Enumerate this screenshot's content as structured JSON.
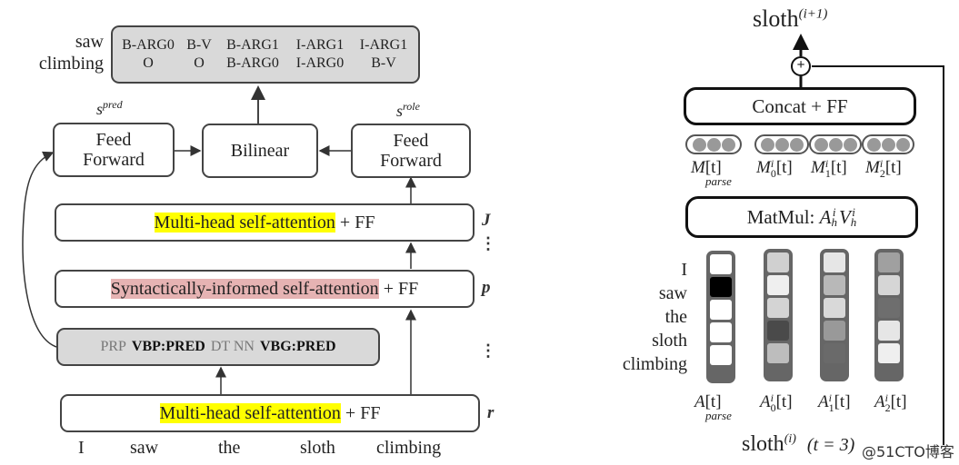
{
  "left_diagram": {
    "output_rows": {
      "row_labels": [
        "saw",
        "climbing"
      ],
      "row1": [
        "B-ARG0",
        "B-V",
        "B-ARG1",
        "I-ARG1",
        "I-ARG1"
      ],
      "row2": [
        "O",
        "O",
        "B-ARG0",
        "I-ARG0",
        "B-V"
      ]
    },
    "s_pred_label": "s",
    "s_pred_sup": "pred",
    "s_role_label": "s",
    "s_role_sup": "role",
    "ff_left": {
      "line1": "Feed",
      "line2": "Forward"
    },
    "bilinear": "Bilinear",
    "ff_right": {
      "line1": "Feed",
      "line2": "Forward"
    },
    "layer_top": {
      "highlight": "Multi-head self-attention",
      "rest": " + FF",
      "index": "J"
    },
    "layer_mid": {
      "highlight": "Syntactically-informed self-attention",
      "rest": " + FF",
      "index": "p"
    },
    "pos_tags": [
      {
        "text": "PRP",
        "style": "light"
      },
      {
        "text": "VBP:PRED",
        "style": "bold"
      },
      {
        "text": "DT NN",
        "style": "light"
      },
      {
        "text": "VBG:PRED",
        "style": "bold"
      }
    ],
    "layer_bottom": {
      "highlight": "Multi-head self-attention",
      "rest": " + FF",
      "index": "r"
    },
    "vdots": "⋮",
    "words": [
      "I",
      "saw",
      "the",
      "sloth",
      "climbing"
    ]
  },
  "right_diagram": {
    "output_label": "sloth",
    "output_sup": "(i+1)",
    "plus_symbol": "+",
    "concat_ff": "Concat + FF",
    "m_labels": [
      {
        "base": "M",
        "sup": "",
        "sub": "parse",
        "arg": "[t]"
      },
      {
        "base": "M",
        "sup": "i",
        "sub": "0",
        "arg": "[t]"
      },
      {
        "base": "M",
        "sup": "i",
        "sub": "1",
        "arg": "[t]"
      },
      {
        "base": "M",
        "sup": "i",
        "sub": "2",
        "arg": "[t]"
      }
    ],
    "matmul_label": "MatMul: ",
    "matmul_a": "A",
    "matmul_v": "V",
    "matmul_sup": "i",
    "matmul_sub": "h",
    "words": [
      "I",
      "saw",
      "the",
      "sloth",
      "climbing"
    ],
    "attention_columns": [
      {
        "cells": [
          "#ffffff",
          "#000000",
          "#ffffff",
          "#ffffff",
          "#ffffff"
        ]
      },
      {
        "cells": [
          "#d0d0d0",
          "#efefef",
          "#d4d4d4",
          "#4a4a4a",
          "#bdbdbd"
        ]
      },
      {
        "cells": [
          "#e6e6e6",
          "#b8b8b8",
          "#d9d9d9",
          "#999999",
          "#6a6a6a"
        ]
      },
      {
        "cells": [
          "#a0a0a0",
          "#d6d6d6",
          "#6e6e6e",
          "#e6e6e6",
          "#efefef"
        ]
      }
    ],
    "a_labels": [
      {
        "base": "A",
        "sup": "",
        "sub": "parse",
        "arg": "[t]"
      },
      {
        "base": "A",
        "sup": "i",
        "sub": "0",
        "arg": "[t]"
      },
      {
        "base": "A",
        "sup": "i",
        "sub": "1",
        "arg": "[t]"
      },
      {
        "base": "A",
        "sup": "i",
        "sub": "2",
        "arg": "[t]"
      }
    ],
    "input_label": "sloth",
    "input_sup": "(i)",
    "input_cond": "(t = 3)"
  },
  "watermark": "@51CTO博客",
  "colors": {
    "highlight_yellow": "#ffff00",
    "highlight_pink": "#e6b3b3",
    "gray_box": "#d9d9d9"
  }
}
